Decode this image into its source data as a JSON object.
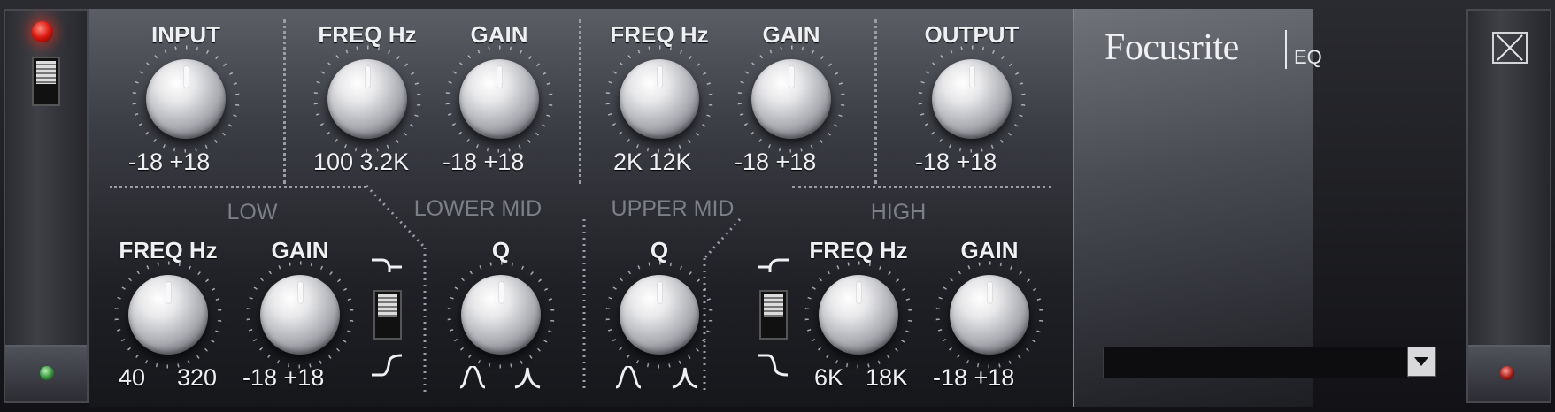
{
  "plugin": {
    "brand": "Focusrite",
    "product": "EQ",
    "preset_value": ""
  },
  "top_row": {
    "input": {
      "label": "INPUT",
      "range": "-18 +18"
    },
    "lower_mid_freq": {
      "label": "FREQ Hz",
      "range": "100 3.2K"
    },
    "lower_mid_gain": {
      "label": "GAIN",
      "range": "-18 +18"
    },
    "upper_mid_freq": {
      "label": "FREQ Hz",
      "range": "2K 12K"
    },
    "upper_mid_gain": {
      "label": "GAIN",
      "range": "-18 +18"
    },
    "output": {
      "label": "OUTPUT",
      "range": "-18 +18"
    }
  },
  "sections": {
    "low": "LOW",
    "lower_mid": "LOWER MID",
    "upper_mid": "UPPER MID",
    "high": "HIGH"
  },
  "bottom_row": {
    "low_freq": {
      "label": "FREQ Hz",
      "range_min": "40",
      "range_max": "320"
    },
    "low_gain": {
      "label": "GAIN",
      "range": "-18 +18"
    },
    "lower_mid_q": {
      "label": "Q"
    },
    "upper_mid_q": {
      "label": "Q"
    },
    "high_freq": {
      "label": "FREQ Hz",
      "range_min": "6K",
      "range_max": "18K"
    },
    "high_gain": {
      "label": "GAIN",
      "range": "-18 +18"
    }
  },
  "icons": {
    "power_led": "power-led-red",
    "bypass_switch": "toggle-switch",
    "close": "close-x-icon",
    "preset_dropdown": "chevron-down-icon"
  },
  "colors": {
    "power_led": "#e01a10",
    "status_led_left": "#2f8f36",
    "status_led_right": "#a31711",
    "panel_text": "#eef0f2",
    "section_text": "#7c7f87"
  }
}
